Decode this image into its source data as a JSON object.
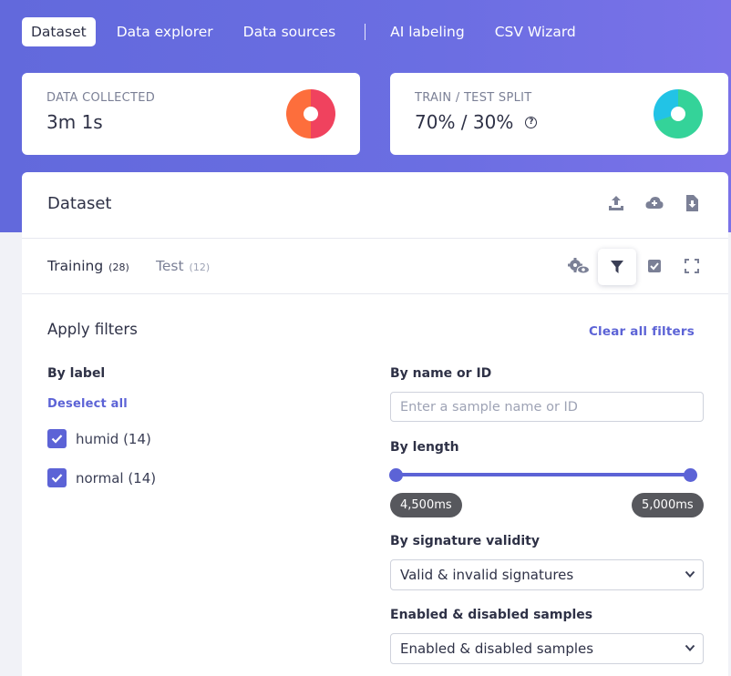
{
  "nav": {
    "items": [
      {
        "label": "Dataset",
        "active": true
      },
      {
        "label": "Data explorer",
        "active": false
      },
      {
        "label": "Data sources",
        "active": false
      },
      {
        "label": "AI labeling",
        "active": false
      },
      {
        "label": "CSV Wizard",
        "active": false
      }
    ]
  },
  "stats": {
    "collected": {
      "label": "DATA COLLECTED",
      "value": "3m 1s",
      "pie": [
        {
          "pct": 50,
          "color": "#f0425e"
        },
        {
          "pct": 50,
          "color": "#fd6e3c"
        }
      ]
    },
    "split": {
      "label": "TRAIN / TEST SPLIT",
      "value": "70% / 30%",
      "help_icon": "question-circle-icon",
      "pie": [
        {
          "pct": 70,
          "color": "#34d399"
        },
        {
          "pct": 30,
          "color": "#22c3e6"
        }
      ]
    }
  },
  "dataset": {
    "title": "Dataset",
    "header_icons": [
      "upload-icon",
      "cloud-add-icon",
      "download-file-icon"
    ],
    "tabs": [
      {
        "label": "Training",
        "count": "(28)",
        "active": true
      },
      {
        "label": "Test",
        "count": "(12)",
        "active": false
      }
    ],
    "tab_icons": [
      "settings-view-icon",
      "filter-icon",
      "select-checkbox-icon",
      "fullscreen-icon"
    ],
    "active_tab_icon": "filter-icon"
  },
  "filters": {
    "title": "Apply filters",
    "clear_all": "Clear all filters",
    "by_label": {
      "title": "By label",
      "deselect_all": "Deselect all",
      "labels": [
        {
          "text": "humid (14)",
          "checked": true
        },
        {
          "text": "normal (14)",
          "checked": true
        }
      ]
    },
    "by_name": {
      "title": "By name or ID",
      "value": "",
      "placeholder": "Enter a sample name or ID"
    },
    "by_length": {
      "title": "By length",
      "min": "4,500ms",
      "max": "5,000ms",
      "range_fraction": [
        0,
        1
      ]
    },
    "by_signature": {
      "title": "By signature validity",
      "selected": "Valid & invalid signatures"
    },
    "by_enabled": {
      "title": "Enabled & disabled samples",
      "selected": "Enabled & disabled samples"
    }
  },
  "colors": {
    "accent": "#5c63d6",
    "hero": "#6269dc"
  }
}
